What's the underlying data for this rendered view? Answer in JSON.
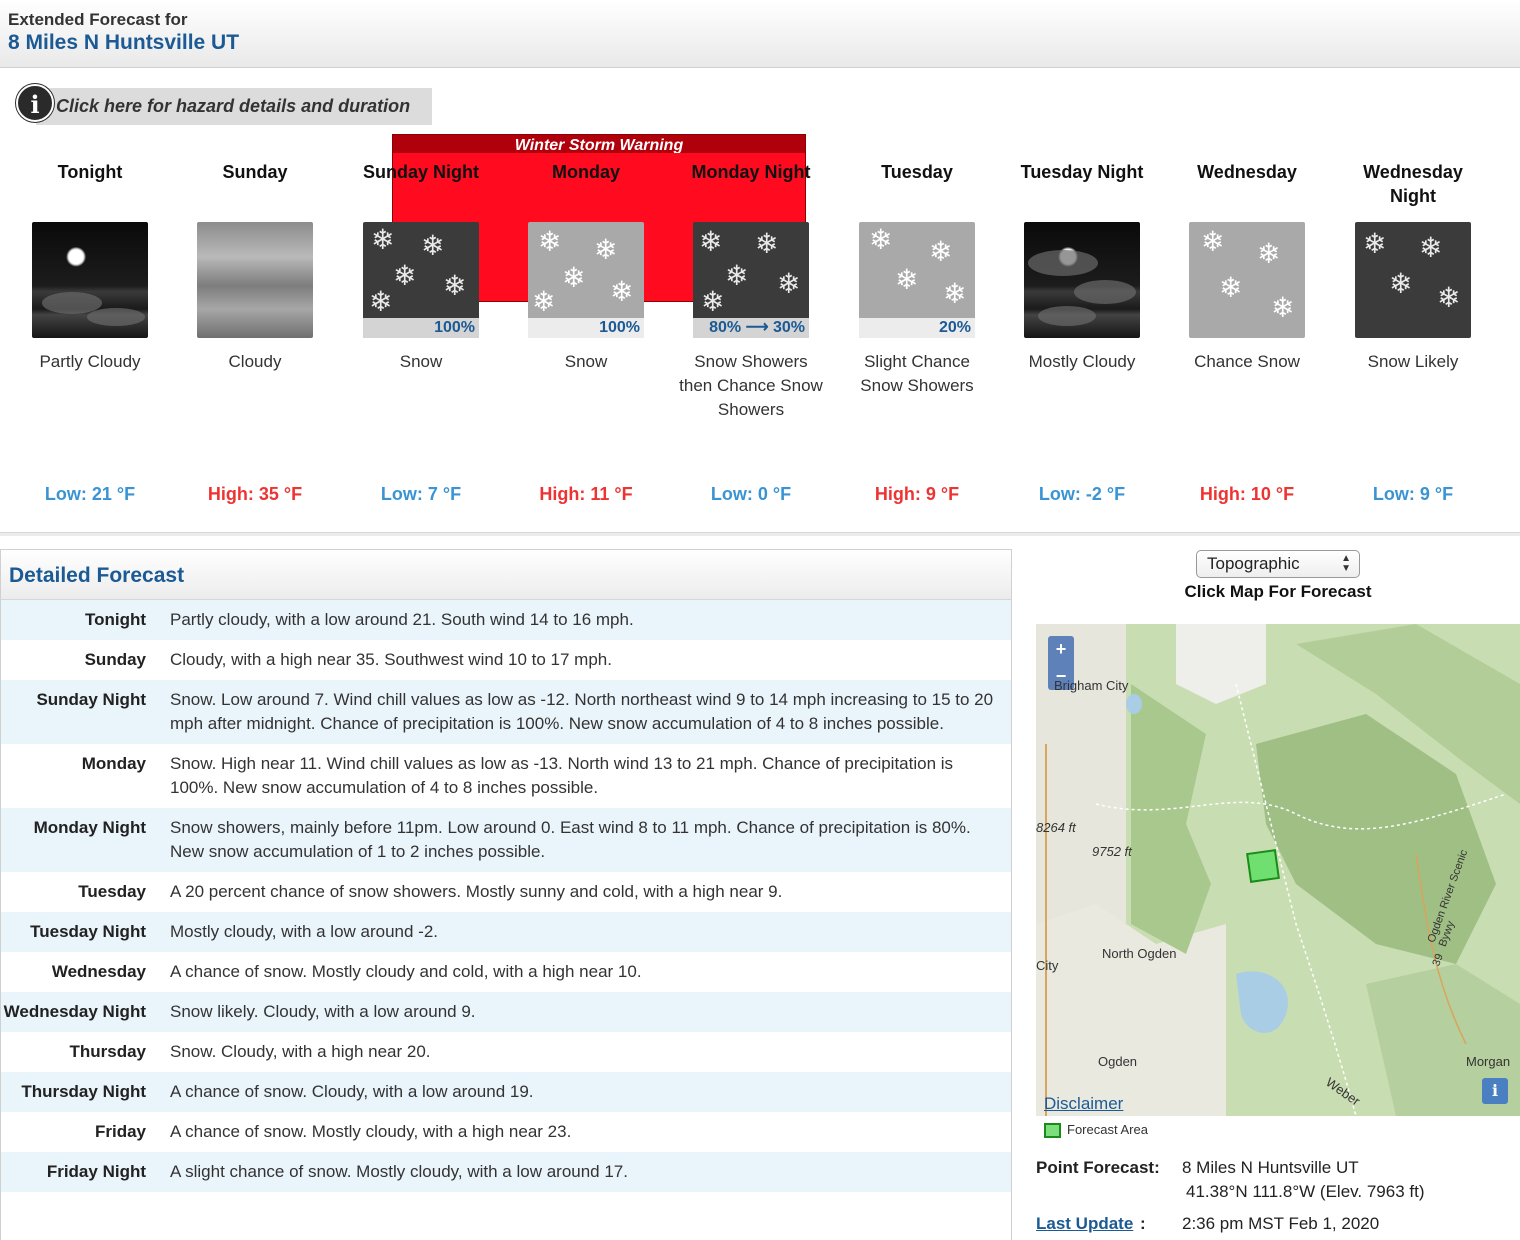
{
  "header": {
    "subtitle": "Extended Forecast for",
    "location": "8 Miles N Huntsville UT"
  },
  "hazard": {
    "link_text": "Click here for hazard details and duration",
    "warning_title": "Winter Storm Warning"
  },
  "periods": [
    {
      "name": "Tonight",
      "icon": "partly-cloudy-night-icon",
      "pop": "",
      "desc": "Partly Cloudy",
      "temp": "Low: 21 °F"
    },
    {
      "name": "Sunday",
      "icon": "cloudy-icon",
      "pop": "",
      "desc": "Cloudy",
      "temp": "High: 35 °F"
    },
    {
      "name": "Sunday Night",
      "icon": "snow-night-icon",
      "pop": "100%",
      "desc": "Snow",
      "temp": "Low: 7 °F"
    },
    {
      "name": "Monday",
      "icon": "snow-day-icon",
      "pop": "100%",
      "desc": "Snow",
      "temp": "High: 11 °F"
    },
    {
      "name": "Monday Night",
      "icon": "snow-showers-night-icon",
      "pop": "80% ⟶ 30%",
      "desc": "Snow Showers then Chance Snow Showers",
      "temp": "Low: 0 °F"
    },
    {
      "name": "Tuesday",
      "icon": "snow-showers-day-icon",
      "pop": "20%",
      "desc": "Slight Chance Snow Showers",
      "temp": "High: 9 °F"
    },
    {
      "name": "Tuesday Night",
      "icon": "mostly-cloudy-night-icon",
      "pop": "",
      "desc": "Mostly Cloudy",
      "temp": "Low: -2 °F"
    },
    {
      "name": "Wednesday",
      "icon": "chance-snow-day-icon",
      "pop": "",
      "desc": "Chance Snow",
      "temp": "High: 10 °F"
    },
    {
      "name": "Wednesday Night",
      "icon": "snow-likely-night-icon",
      "pop": "",
      "desc": "Snow Likely",
      "temp": "Low: 9 °F"
    }
  ],
  "detailed": {
    "title": "Detailed Forecast",
    "rows": [
      {
        "label": "Tonight",
        "text": "Partly cloudy, with a low around 21. South wind 14 to 16 mph."
      },
      {
        "label": "Sunday",
        "text": "Cloudy, with a high near 35. Southwest wind 10 to 17 mph."
      },
      {
        "label": "Sunday Night",
        "text": "Snow. Low around 7. Wind chill values as low as -12. North northeast wind 9 to 14 mph increasing to 15 to 20 mph after midnight. Chance of precipitation is 100%. New snow accumulation of 4 to 8 inches possible."
      },
      {
        "label": "Monday",
        "text": "Snow. High near 11. Wind chill values as low as -13. North wind 13 to 21 mph. Chance of precipitation is 100%. New snow accumulation of 4 to 8 inches possible."
      },
      {
        "label": "Monday Night",
        "text": "Snow showers, mainly before 11pm. Low around 0. East wind 8 to 11 mph. Chance of precipitation is 80%. New snow accumulation of 1 to 2 inches possible."
      },
      {
        "label": "Tuesday",
        "text": "A 20 percent chance of snow showers. Mostly sunny and cold, with a high near 9."
      },
      {
        "label": "Tuesday Night",
        "text": "Mostly cloudy, with a low around -2."
      },
      {
        "label": "Wednesday",
        "text": "A chance of snow. Mostly cloudy and cold, with a high near 10."
      },
      {
        "label": "Wednesday Night",
        "text": "Snow likely. Cloudy, with a low around 9."
      },
      {
        "label": "Thursday",
        "text": "Snow. Cloudy, with a high near 20."
      },
      {
        "label": "Thursday Night",
        "text": "A chance of snow. Cloudy, with a low around 19."
      },
      {
        "label": "Friday",
        "text": "A chance of snow. Mostly cloudy, with a high near 23."
      },
      {
        "label": "Friday Night",
        "text": "A slight chance of snow. Mostly cloudy, with a low around 17."
      }
    ]
  },
  "map": {
    "type_selected": "Topographic",
    "click_label": "Click Map For Forecast",
    "zoom_in": "+",
    "zoom_out": "−",
    "labels": {
      "brigham": "Brigham City",
      "elev1": "8264 ft",
      "elev2": "9752 ft",
      "north_ogden": "North Ogden",
      "ogden": "Ogden",
      "city": "City",
      "morgan": "Morgan",
      "weber": "Weber",
      "byway": "Ogden River Scenic Bywy",
      "route": "39"
    },
    "disclaimer": "Disclaimer",
    "legend": "Forecast Area"
  },
  "point": {
    "label": "Point Forecast:",
    "name": "8 Miles N Huntsville UT",
    "coords": "41.38°N 111.8°W (Elev. 7963 ft)",
    "update_label": "Last Update",
    "update_colon": ":",
    "update_value": "2:36 pm MST Feb 1, 2020"
  },
  "colors": {
    "link_blue": "#1b5a94",
    "low_temp": "#3a94d3",
    "high_temp": "#ee3333",
    "warning_red": "#ff0a1e"
  }
}
